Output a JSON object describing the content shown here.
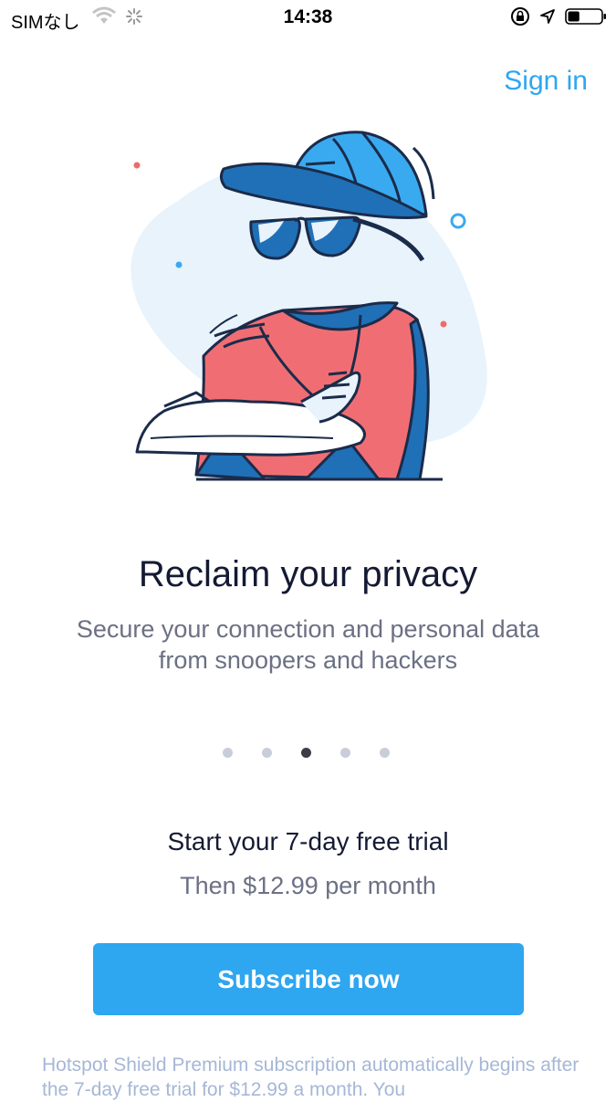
{
  "status_bar": {
    "carrier": "SIMなし",
    "time": "14:38",
    "battery_fill": 0.35
  },
  "header": {
    "sign_in": "Sign in"
  },
  "onboarding": {
    "title": "Reclaim your privacy",
    "subtitle": "Secure your connection and personal data from snoopers and hackers",
    "page_count": 5,
    "active_page": 3
  },
  "offer": {
    "heading": "Start your 7-day free trial",
    "price": "Then $12.99 per month",
    "button": "Subscribe now"
  },
  "legal": {
    "text": "Hotspot Shield Premium subscription automatically begins after the 7-day free trial for $12.99 a month. You"
  },
  "colors": {
    "accent": "#2fa6f0",
    "title": "#141a33",
    "muted": "#6b7084",
    "legal": "#a6b7d6",
    "shirt": "#f06e73"
  }
}
